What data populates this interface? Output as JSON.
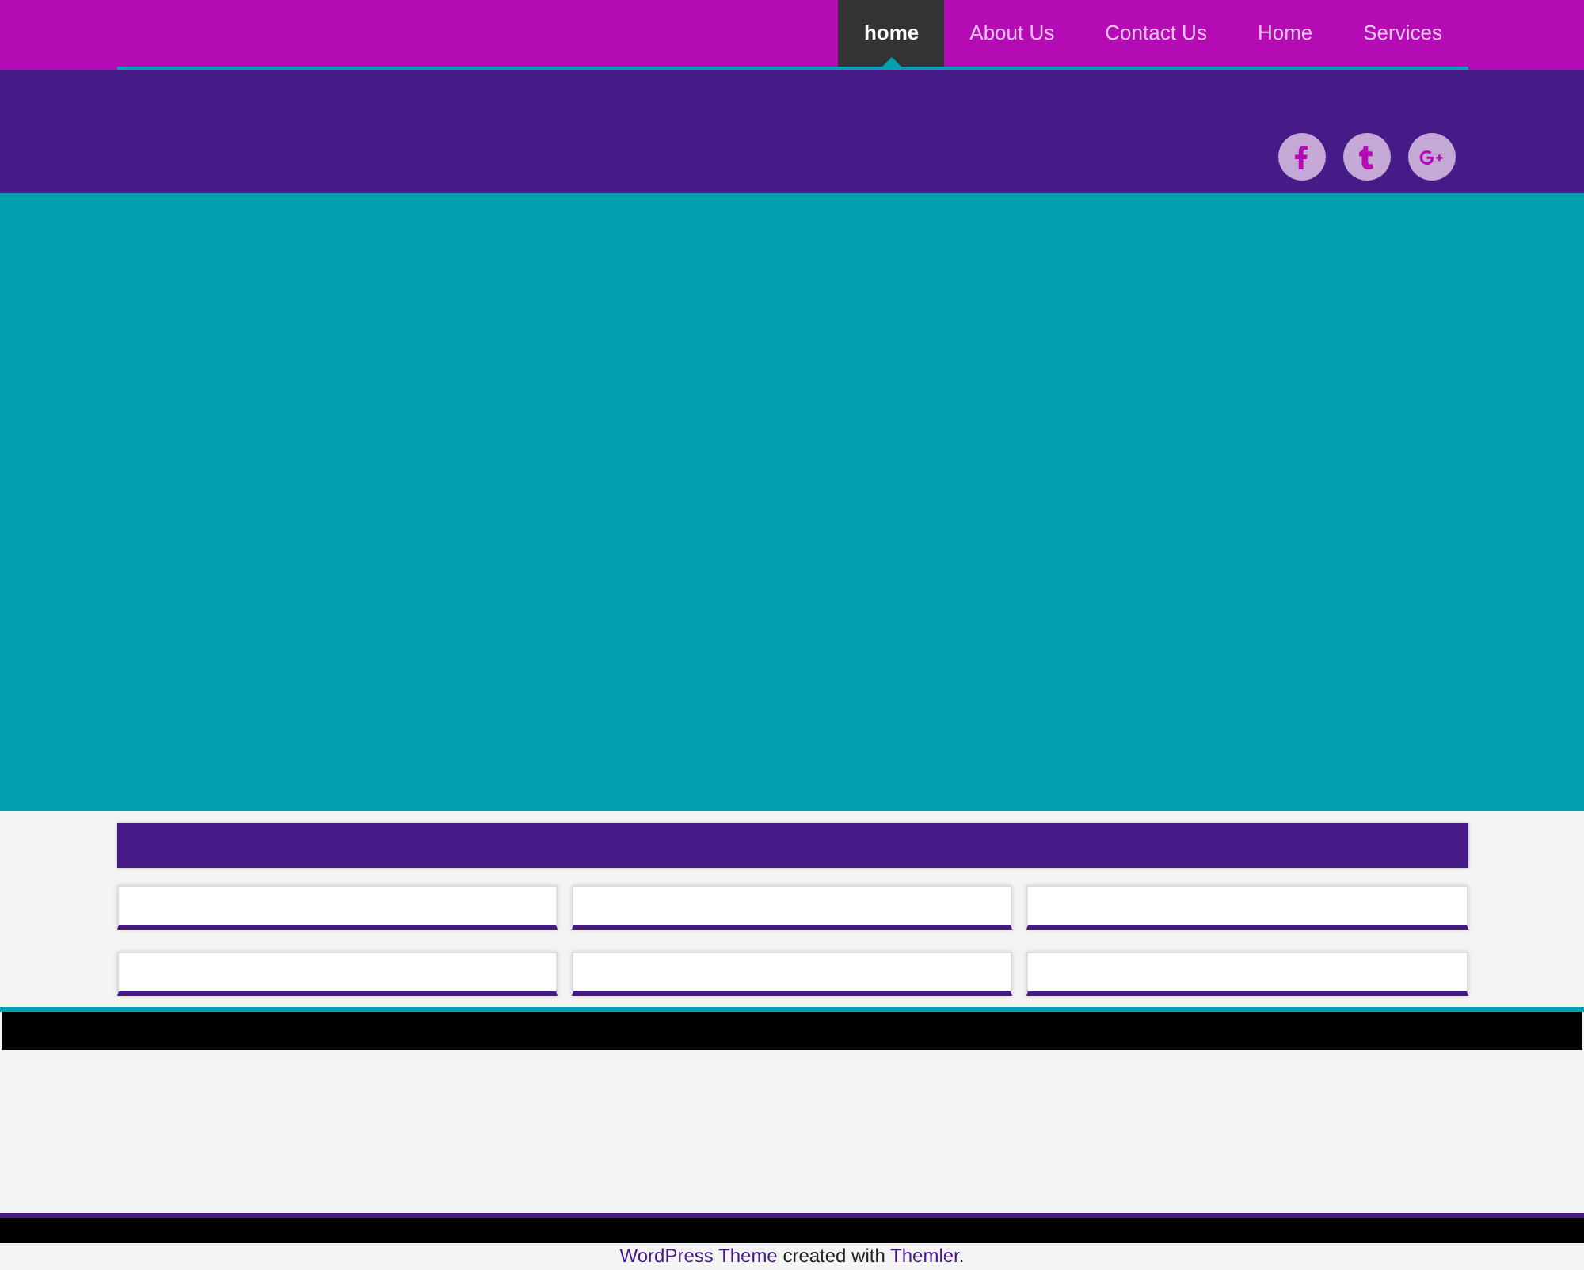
{
  "nav": [
    {
      "label": "home",
      "selected": true
    },
    {
      "label": "About Us",
      "selected": false
    },
    {
      "label": "Contact Us",
      "selected": false
    },
    {
      "label": "Home",
      "selected": false
    },
    {
      "label": "Services",
      "selected": false
    }
  ],
  "social": [
    {
      "kind": "facebook"
    },
    {
      "kind": "tumblr"
    },
    {
      "kind": "googleplus"
    }
  ],
  "footer": [
    {
      "kind": "link",
      "text": "WordPress Theme"
    },
    {
      "kind": "text",
      "text": " created with "
    },
    {
      "kind": "link",
      "text": "Themler"
    },
    {
      "kind": "text",
      "text": "."
    }
  ]
}
